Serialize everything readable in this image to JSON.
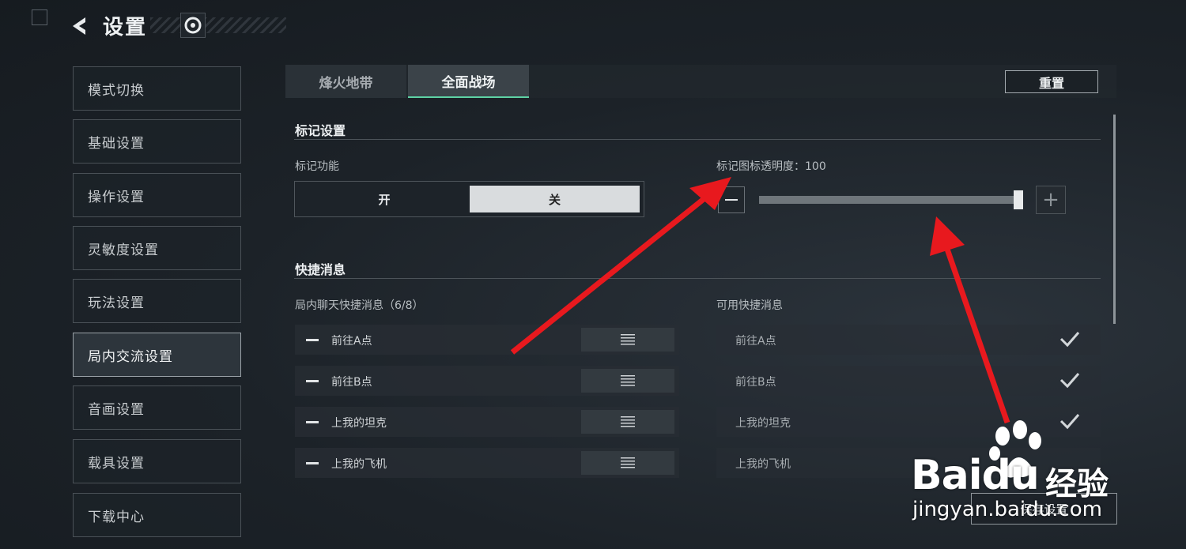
{
  "header": {
    "title": "设置"
  },
  "sidebar": {
    "items": [
      {
        "label": "模式切换"
      },
      {
        "label": "基础设置"
      },
      {
        "label": "操作设置"
      },
      {
        "label": "灵敏度设置"
      },
      {
        "label": "玩法设置"
      },
      {
        "label": "局内交流设置",
        "active": true
      },
      {
        "label": "音画设置"
      },
      {
        "label": "载具设置"
      },
      {
        "label": "下载中心"
      }
    ]
  },
  "tabs": [
    {
      "label": "烽火地带"
    },
    {
      "label": "全面战场",
      "active": true
    }
  ],
  "toolbar": {
    "reset_label": "重置"
  },
  "marker": {
    "section_title": "标记设置",
    "function_label": "标记功能",
    "toggle_on": "开",
    "toggle_off": "关",
    "toggle_selected": "关",
    "opacity_label": "标记图标透明度：100",
    "opacity_value": 100,
    "opacity_fraction": 1.0
  },
  "quick_msg": {
    "section_title": "快捷消息",
    "ingame_label": "局内聊天快捷消息（6/8）",
    "available_label": "可用快捷消息",
    "ingame_items": [
      "前往A点",
      "前往B点",
      "上我的坦克",
      "上我的飞机"
    ],
    "available_items": [
      "前往A点",
      "前往B点",
      "上我的坦克",
      "上我的飞机"
    ]
  },
  "footer": {
    "save_label": "保存设置"
  },
  "watermark": {
    "brand": "Bai",
    "brand_tail": "du",
    "product": "经验",
    "url": "jingyan.baidu.com"
  },
  "colors": {
    "accent": "#5ed2a4",
    "arrow": "#e8191e",
    "background": "#1c2228"
  },
  "icons": [
    "back-arrow-icon",
    "settings-head-icon",
    "minus-icon",
    "plus-icon",
    "drag-handle-icon",
    "check-icon",
    "baidu-paw-logo"
  ]
}
